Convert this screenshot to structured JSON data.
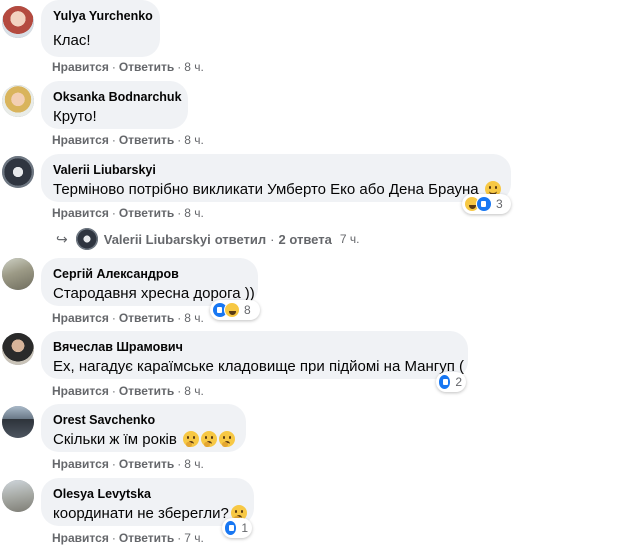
{
  "actions": {
    "like": "Нравится",
    "reply": "Ответить",
    "sep": "·"
  },
  "comments": [
    {
      "author": "Yulya Yurchenko",
      "text": "Клас!",
      "time": "8 ч."
    },
    {
      "author": "Oksanka Bodnarchuk",
      "text": "Круто!",
      "time": "8 ч."
    },
    {
      "author": "Valerii Liubarskyi",
      "text": "Терміново потрібно викликати Умберто Еко або Дена Брауна",
      "time": "8 ч.",
      "emoji": "slight-smile-emoji",
      "reactions": {
        "icons": [
          "haha",
          "like"
        ],
        "count": "3"
      }
    },
    {
      "author": "Сергій Александров",
      "text": "Стародавня хресна дорога ))",
      "time": "8 ч.",
      "reactions": {
        "icons": [
          "like",
          "haha"
        ],
        "count": "8"
      }
    },
    {
      "author": "Вячеслав Шрамович",
      "text": "Ех, нагадує караїмське кладовище при підйомі на Мангуп (",
      "time": "8 ч.",
      "reactions": {
        "icons": [
          "like"
        ],
        "count": "2"
      }
    },
    {
      "author": "Orest Savchenko",
      "text": "Скільки ж їм років",
      "time": "8 ч.",
      "emoji": "thinking-emoji-x3"
    },
    {
      "author": "Olesya Levytska",
      "text": "координати не зберегли?",
      "time": "7 ч.",
      "emoji": "thinking-emoji",
      "reactions": {
        "icons": [
          "like"
        ],
        "count": "1"
      }
    }
  ],
  "replies_summary": {
    "author": "Valerii Liubarskyi",
    "verb": "ответил",
    "sep": "·",
    "count_label": "2 ответа",
    "time": "7 ч."
  },
  "colors": {
    "bubble": "#f0f2f5",
    "meta": "#65676b",
    "like_blue": "#1877f2"
  }
}
